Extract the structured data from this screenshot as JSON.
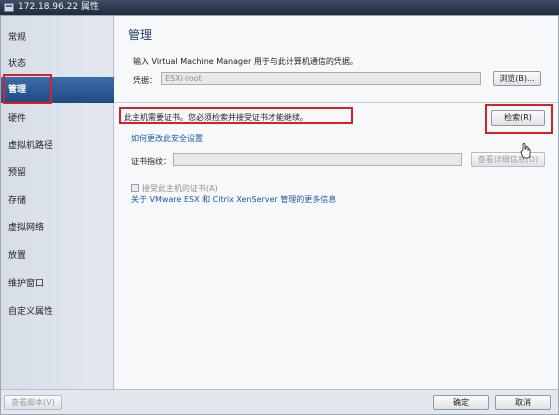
{
  "window": {
    "title": "172.18.96.22 属性"
  },
  "nav": {
    "items": [
      {
        "label": "常规"
      },
      {
        "label": "状态"
      },
      {
        "label": "管理"
      },
      {
        "label": "硬件"
      },
      {
        "label": "虚拟机路径"
      },
      {
        "label": "预留"
      },
      {
        "label": "存储"
      },
      {
        "label": "虚拟网络"
      },
      {
        "label": "放置"
      },
      {
        "label": "维护窗口"
      },
      {
        "label": "自定义属性"
      }
    ],
    "selected": "管理"
  },
  "main": {
    "heading": "管理",
    "credentials_instruction": "输入 Virtual Machine Manager 用于与此计算机通信的凭据。",
    "credentials_label": "凭据：",
    "credentials_value": "ESXi-root",
    "browse_button": "浏览(B)...",
    "cert_warning": "此主机需要证书。您必须检索并接受证书才能继续。",
    "retrieve_button": "检索(R)",
    "security_link": "如何更改此安全设置",
    "thumbprint_label": "证书指纹：",
    "thumbprint_value": "",
    "view_details_button": "查看详细信息(D)",
    "accept_cert_label": "接受此主机的证书(A)",
    "more_info_link": "关于 VMware ESX 和 Citrix XenServer 管理的更多信息"
  },
  "footer": {
    "view_script_button": "查看脚本(V)",
    "ok_button": "确定",
    "cancel_button": "取消"
  },
  "colors": {
    "highlight": "#d2232a",
    "selected_nav": "#1f4a82",
    "link": "#1f56a8"
  }
}
